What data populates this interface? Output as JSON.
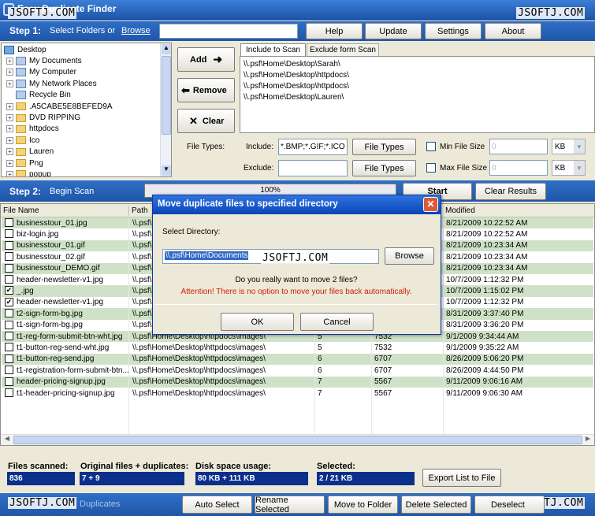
{
  "window": {
    "title": "Easy Duplicate Finder"
  },
  "watermarks": {
    "top_left": "JSOFTJ.COM",
    "top_right": "JSOFTJ.COM",
    "center": "JSOFTJ.COM",
    "bottom_left": "JSOFTJ.COM",
    "bottom_right": "JSOFTJ.COM"
  },
  "step1": {
    "label": "Step 1:",
    "text": "Select Folders or",
    "browse_link": "Browse",
    "folder_input": ""
  },
  "top_buttons": {
    "help": "Help",
    "update": "Update",
    "settings": "Settings",
    "about": "About"
  },
  "tree": {
    "items": [
      {
        "label": "Desktop",
        "icon": "desktop-icon"
      },
      {
        "label": "My Documents",
        "icon": "documents-icon"
      },
      {
        "label": "My Computer",
        "icon": "computer-icon"
      },
      {
        "label": "My Network Places",
        "icon": "network-icon"
      },
      {
        "label": "Recycle Bin",
        "icon": "recycle-bin-icon"
      },
      {
        "label": ".A5CABE5E8BEFED9A",
        "icon": "folder-icon"
      },
      {
        "label": "DVD RIPPING",
        "icon": "folder-icon"
      },
      {
        "label": "httpdocs",
        "icon": "folder-icon"
      },
      {
        "label": "Ico",
        "icon": "folder-icon"
      },
      {
        "label": "Lauren",
        "icon": "folder-icon"
      },
      {
        "label": "Png",
        "icon": "folder-icon"
      },
      {
        "label": "popup",
        "icon": "folder-icon"
      }
    ]
  },
  "actions": {
    "add": "Add",
    "remove": "Remove",
    "clear": "Clear"
  },
  "tabs": {
    "include": "Include to Scan",
    "exclude": "Exclude form Scan"
  },
  "scan_paths": [
    "\\\\.psf\\Home\\Desktop\\Sarah\\",
    "\\\\.psf\\Home\\Desktop\\httpdocs\\",
    "\\\\.psf\\Home\\Desktop\\httpdocs\\",
    "\\\\.psf\\Home\\Desktop\\Lauren\\"
  ],
  "filetypes": {
    "label": "File Types:",
    "include_label": "Include:",
    "include_value": "*.BMP;*.GIF;*.ICO;*.",
    "exclude_label": "Exclude:",
    "exclude_value": "",
    "button": "File Types",
    "min_label": "Min File Size",
    "max_label": "Max File Size",
    "min_value": "0",
    "max_value": "0",
    "unit": "KB"
  },
  "step2": {
    "label": "Step 2:",
    "text": "Begin Scan",
    "progress_text": "100%",
    "progress": 1.0,
    "start": "Start",
    "clear_results": "Clear Results"
  },
  "grid": {
    "headers": [
      "File Name",
      "Path",
      "",
      "",
      "Modified"
    ],
    "rows": [
      {
        "name": "businesstour_01.jpg",
        "path": "\\\\.psf\\",
        "group": "",
        "size": "",
        "modified": "8/21/2009 10:22:52 AM",
        "checked": false
      },
      {
        "name": "biz-login.jpg",
        "path": "\\\\.psf\\",
        "group": "",
        "size": "",
        "modified": "8/21/2009 10:22:52 AM",
        "checked": false
      },
      {
        "name": "businesstour_01.gif",
        "path": "\\\\.psf\\",
        "group": "",
        "size": "",
        "modified": "8/21/2009 10:23:34 AM",
        "checked": false
      },
      {
        "name": "businesstour_02.gif",
        "path": "\\\\.psf\\",
        "group": "",
        "size": "",
        "modified": "8/21/2009 10:23:34 AM",
        "checked": false
      },
      {
        "name": "businesstour_DEMO.gif",
        "path": "\\\\.psf\\",
        "group": "",
        "size": "",
        "modified": "8/21/2009 10:23:34 AM",
        "checked": false
      },
      {
        "name": "header-newsletter-v1.jpg",
        "path": "\\\\.psf\\",
        "group": "",
        "size": "",
        "modified": "10/7/2009 1:12:32 PM",
        "checked": false
      },
      {
        "name": "_.jpg",
        "path": "\\\\.psf\\",
        "group": "",
        "size": "",
        "modified": "10/7/2009 1:15:02 PM",
        "checked": true
      },
      {
        "name": "header-newsletter-v1.jpg",
        "path": "\\\\.psf\\",
        "group": "",
        "size": "",
        "modified": "10/7/2009 1:12:32 PM",
        "checked": true
      },
      {
        "name": "t2-sign-form-bg.jpg",
        "path": "\\\\.psf\\",
        "group": "",
        "size": "",
        "modified": "8/31/2009 3:37:40 PM",
        "checked": false
      },
      {
        "name": "t1-sign-form-bg.jpg",
        "path": "\\\\.psf\\",
        "group": "",
        "size": "",
        "modified": "8/31/2009 3:36:20 PM",
        "checked": false
      },
      {
        "name": "t1-reg-form-submit-btn-wht.jpg",
        "path": "\\\\.psf\\Home\\Desktop\\httpdocs\\images\\",
        "group": "5",
        "size": "7532",
        "modified": "9/1/2009 9:34:44 AM",
        "checked": false
      },
      {
        "name": "t1-button-reg-send-wht.jpg",
        "path": "\\\\.psf\\Home\\Desktop\\httpdocs\\images\\",
        "group": "5",
        "size": "7532",
        "modified": "9/1/2009 9:35:22 AM",
        "checked": false
      },
      {
        "name": "t1-button-reg-send.jpg",
        "path": "\\\\.psf\\Home\\Desktop\\httpdocs\\images\\",
        "group": "6",
        "size": "6707",
        "modified": "8/26/2009 5:06:20 PM",
        "checked": false
      },
      {
        "name": "t1-registration-form-submit-btn...",
        "path": "\\\\.psf\\Home\\Desktop\\httpdocs\\images\\",
        "group": "6",
        "size": "6707",
        "modified": "8/26/2009 4:44:50 PM",
        "checked": false
      },
      {
        "name": "header-pricing-signup.jpg",
        "path": "\\\\.psf\\Home\\Desktop\\httpdocs\\images\\",
        "group": "7",
        "size": "5567",
        "modified": "9/11/2009 9:06:16 AM",
        "checked": false
      },
      {
        "name": "t1-header-pricing-signup.jpg",
        "path": "\\\\.psf\\Home\\Desktop\\httpdocs\\images\\",
        "group": "7",
        "size": "5567",
        "modified": "9/11/2009 9:06:30 AM",
        "checked": false
      }
    ]
  },
  "stats": {
    "scanned_label": "Files scanned:",
    "scanned_value": "836",
    "original_label": "Original files + duplicates:",
    "original_value": "7 + 9",
    "disk_label": "Disk space usage:",
    "disk_value": "80 KB + 111 KB",
    "selected_label": "Selected:",
    "selected_value": "2 / 21 KB",
    "export": "Export List to File"
  },
  "step3": {
    "text": "Duplicates"
  },
  "bottom_buttons": {
    "auto_select": "Auto Select",
    "rename": "Rename Selected",
    "move": "Move to Folder",
    "delete": "Delete Selected",
    "deselect": "Deselect"
  },
  "dialog": {
    "title": "Move duplicate files to specified directory",
    "select_label": "Select Directory:",
    "directory": "\\\\.psf\\Home\\Documents",
    "browse": "Browse",
    "question": "Do you really want to move 2 files?",
    "warning": "Attention! There is no option to move your files back automatically.",
    "ok": "OK",
    "cancel": "Cancel",
    "warning_color": "#cc2200"
  }
}
